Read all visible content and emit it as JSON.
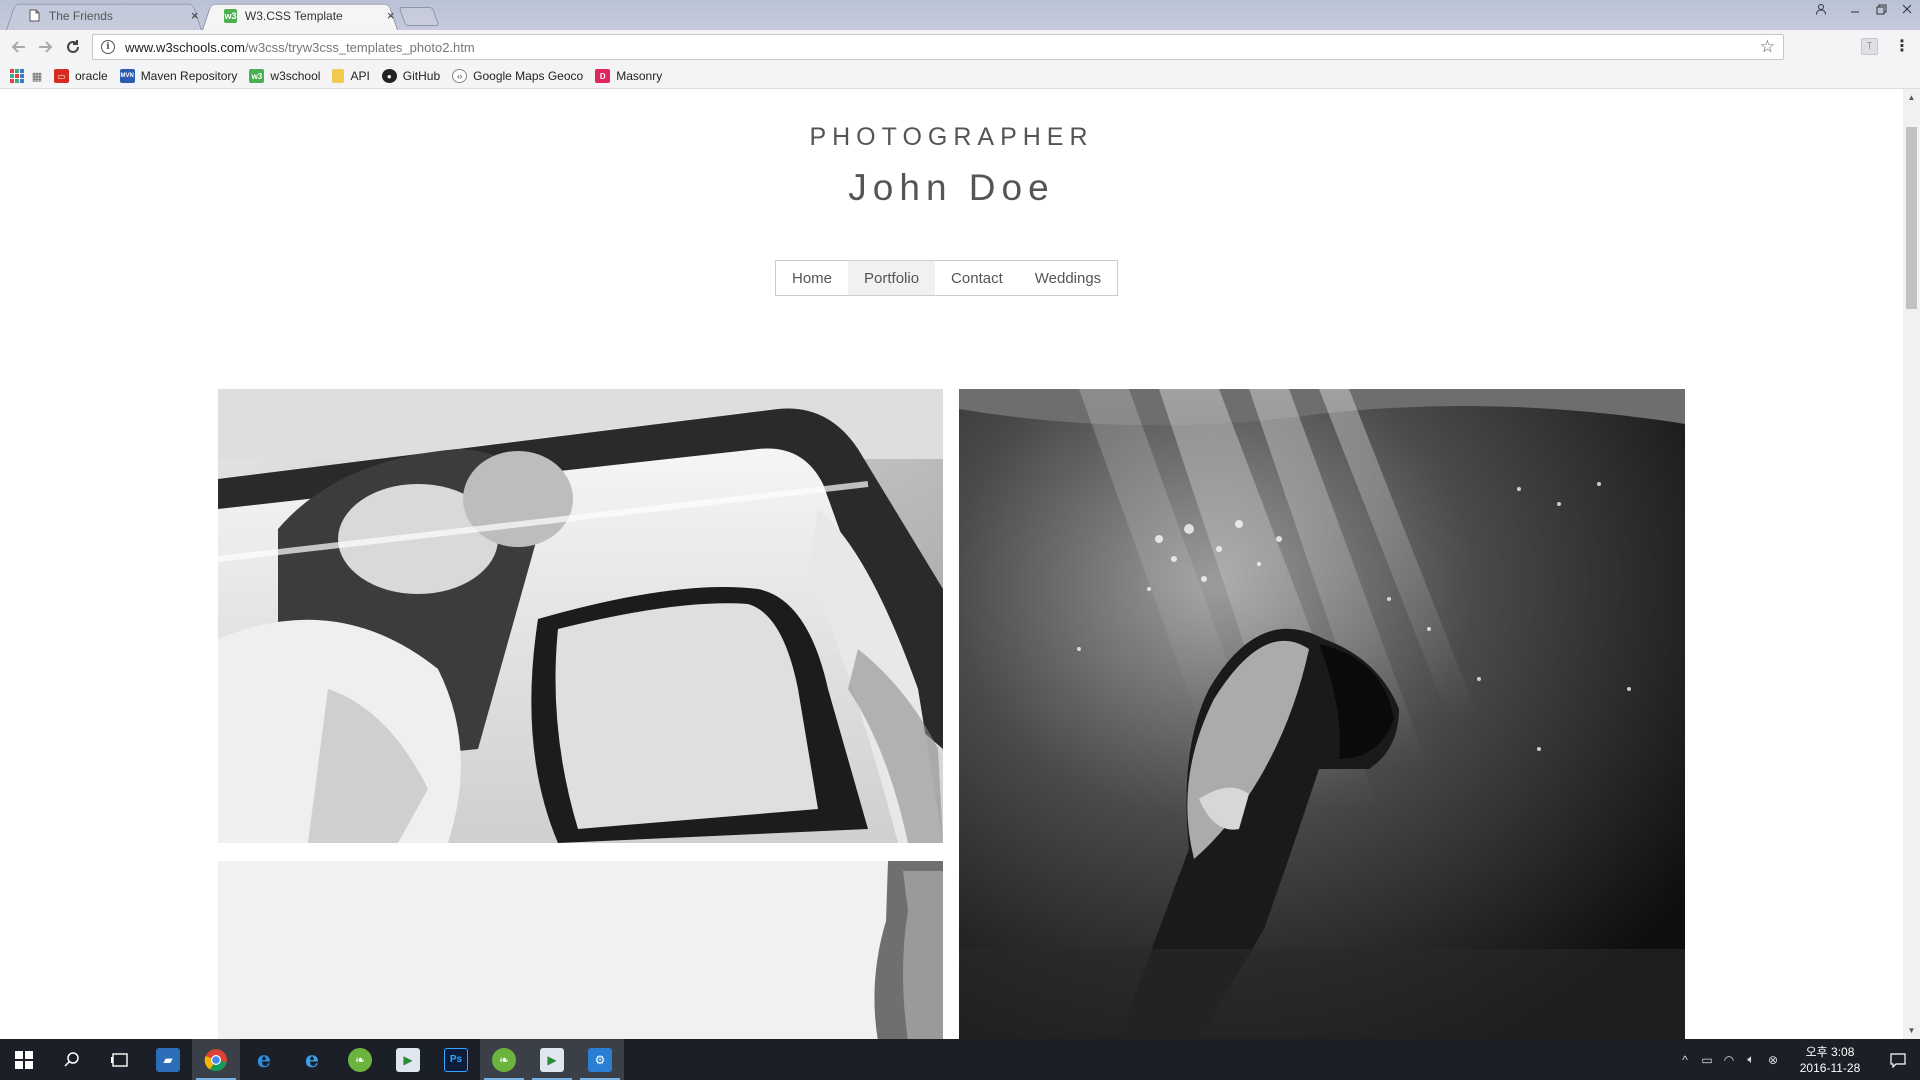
{
  "browser": {
    "tabs": [
      {
        "title": "The Friends",
        "active": false
      },
      {
        "title": "W3.CSS Template",
        "active": true,
        "favicon_text": "w3"
      }
    ],
    "close_glyph": "×",
    "url_host": "www.w3schools.com",
    "url_path": "/w3css/tryw3css_templates_photo2.htm",
    "extension_letter": "T",
    "bookmarks": [
      {
        "label": "oracle",
        "icon": "oracle-icon",
        "color": "#d52b1e"
      },
      {
        "label": "Maven Repository",
        "icon": "maven-icon",
        "color": "#2a5db0",
        "icon_text": "MVN"
      },
      {
        "label": "w3school",
        "icon": "w3school-icon",
        "color": "#4caf50",
        "icon_text": "w3"
      },
      {
        "label": "API",
        "icon": "folder-icon",
        "color": "#f2c94c"
      },
      {
        "label": "GitHub",
        "icon": "github-icon",
        "color": "#222222"
      },
      {
        "label": "Google Maps Geoco",
        "icon": "google-maps-icon",
        "color": "#555555"
      },
      {
        "label": "Masonry",
        "icon": "masonry-icon",
        "color": "#e0245e",
        "icon_text": "D"
      }
    ]
  },
  "site": {
    "tagline": "PHOTOGRAPHER",
    "name": "John Doe",
    "nav": [
      {
        "label": "Home",
        "active": false
      },
      {
        "label": "Portfolio",
        "active": true
      },
      {
        "label": "Contact",
        "active": false
      },
      {
        "label": "Weddings",
        "active": false
      }
    ],
    "photos": [
      {
        "subject": "wedding-car-kiss",
        "style": "black-and-white"
      },
      {
        "subject": "underwater-woman",
        "style": "black-and-white"
      },
      {
        "subject": "partial-third-photo",
        "style": "black-and-white"
      }
    ]
  },
  "taskbar": {
    "clock_period": "오후 3:08",
    "clock_date": "2016-11-28",
    "apps": [
      "start-icon",
      "search-icon",
      "task-view-icon",
      "explorer-icon",
      "chrome-icon",
      "edge-icon",
      "ie-icon",
      "spring-icon",
      "media-player-icon",
      "photoshop-icon",
      "spring-icon-2",
      "media-player-icon-2",
      "settings-icon"
    ]
  },
  "colors": {
    "page_text": "#555555",
    "nav_active_bg": "#f1f1f1",
    "taskbar_bg": "#1b1f27",
    "w3_green": "#4caf50"
  }
}
